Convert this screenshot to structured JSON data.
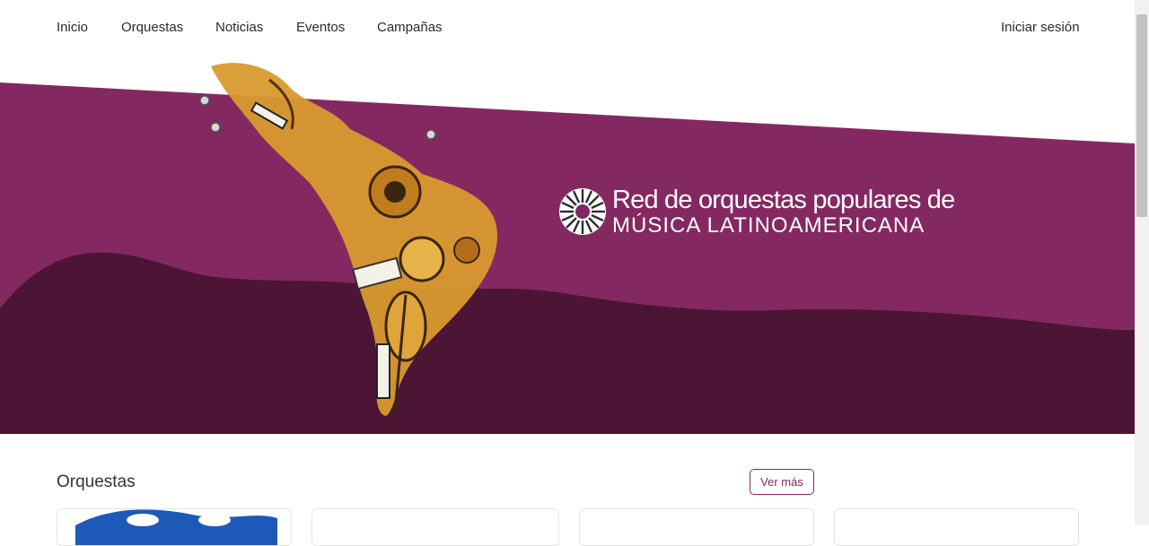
{
  "nav": {
    "items": [
      "Inicio",
      "Orquestas",
      "Noticias",
      "Eventos",
      "Campañas"
    ],
    "login": "Iniciar sesión"
  },
  "hero": {
    "title_line1": "Red de orquestas populares de",
    "title_line2": "MÚSICA LATINOAMERICANA",
    "colors": {
      "band": "#842862",
      "mountains": "#4c1535",
      "instruments": "#d89a2e"
    }
  },
  "orquestas": {
    "title": "Orquestas",
    "more_button": "Ver más"
  }
}
